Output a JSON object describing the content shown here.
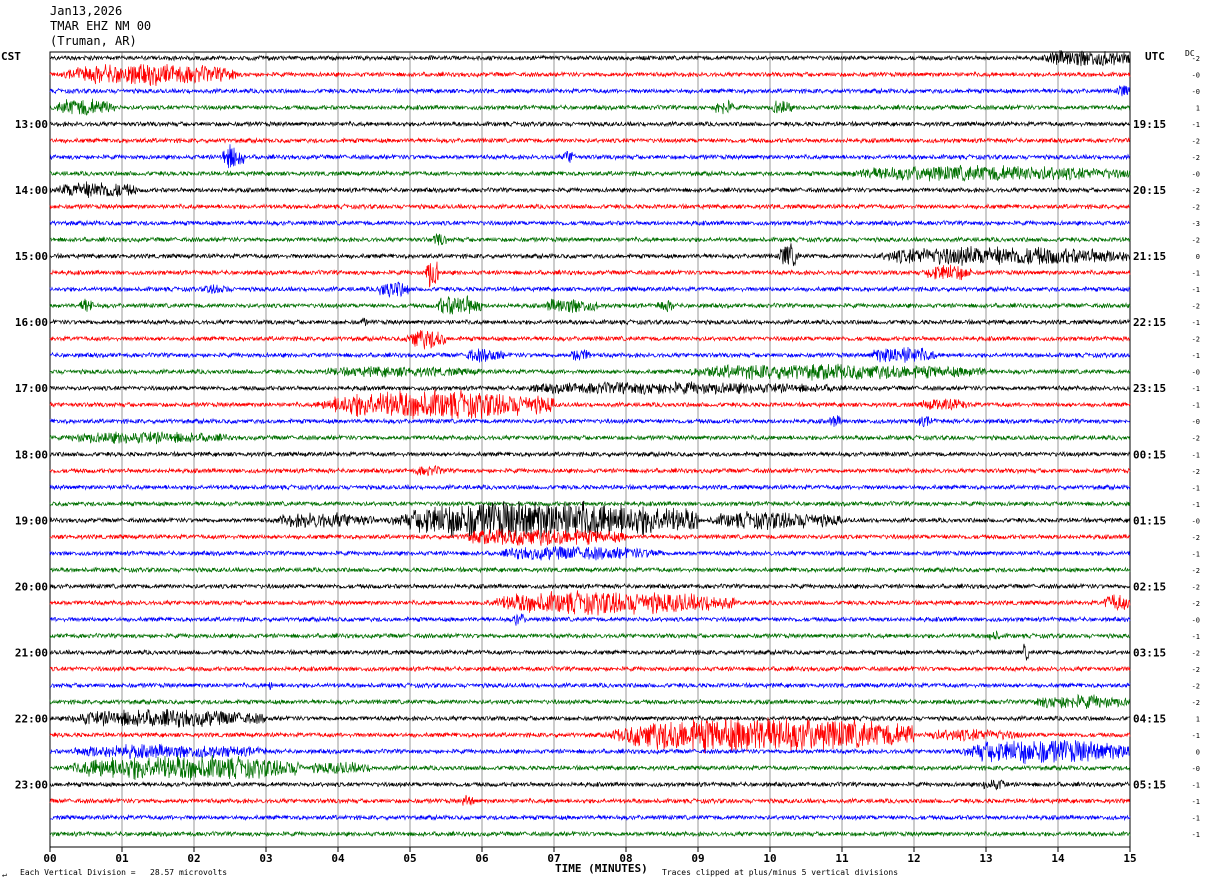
{
  "header": {
    "date": "Jan13,2026",
    "station": "TMAR EHZ NM 00",
    "location": "(Truman, AR)"
  },
  "left_zone": "CST",
  "right_zone": "UTC",
  "dc_label": "DC",
  "footer": {
    "corner_mark": "↵",
    "scale_note": "Each Vertical Division =   28.57 microvolts",
    "xlabel": "TIME (MINUTES)",
    "clip_note": "Traces clipped at plus/minus 5 vertical divisions"
  },
  "colors": {
    "trace_cycle": [
      "#000000",
      "#ff0000",
      "#0000ff",
      "#007000"
    ],
    "grid": "#000000",
    "background": "#ffffff"
  },
  "chart_data": {
    "type": "line",
    "title": "TMAR EHZ NM 00",
    "xlabel": "TIME (MINUTES)",
    "xlim": [
      0,
      15
    ],
    "x_ticks": [
      "00",
      "01",
      "02",
      "03",
      "04",
      "05",
      "06",
      "07",
      "08",
      "09",
      "10",
      "11",
      "12",
      "13",
      "14",
      "15"
    ],
    "trace_count": 48,
    "minutes_per_trace": 15,
    "left_hour_labels": [
      {
        "trace": 4,
        "label": "13:00"
      },
      {
        "trace": 8,
        "label": "14:00"
      },
      {
        "trace": 12,
        "label": "15:00"
      },
      {
        "trace": 16,
        "label": "16:00"
      },
      {
        "trace": 20,
        "label": "17:00"
      },
      {
        "trace": 24,
        "label": "18:00"
      },
      {
        "trace": 28,
        "label": "19:00"
      },
      {
        "trace": 32,
        "label": "20:00"
      },
      {
        "trace": 36,
        "label": "21:00"
      },
      {
        "trace": 40,
        "label": "22:00"
      },
      {
        "trace": 44,
        "label": "23:00"
      }
    ],
    "right_hour_labels": [
      {
        "trace": 4,
        "label": "19:15"
      },
      {
        "trace": 8,
        "label": "20:15"
      },
      {
        "trace": 12,
        "label": "21:15"
      },
      {
        "trace": 16,
        "label": "22:15"
      },
      {
        "trace": 20,
        "label": "23:15"
      },
      {
        "trace": 24,
        "label": "00:15"
      },
      {
        "trace": 28,
        "label": "01:15"
      },
      {
        "trace": 32,
        "label": "02:15"
      },
      {
        "trace": 36,
        "label": "03:15"
      },
      {
        "trace": 40,
        "label": "04:15"
      },
      {
        "trace": 44,
        "label": "05:15"
      }
    ],
    "dc_offsets": [
      -2,
      0,
      0,
      1,
      -1,
      -2,
      -2,
      0,
      -2,
      -2,
      -3,
      -2,
      0,
      -1,
      -1,
      -2,
      -1,
      -2,
      -1,
      0,
      -1,
      -1,
      0,
      -2,
      -1,
      -2,
      -1,
      -1,
      0,
      -2,
      -1,
      -2,
      -2,
      -2,
      0,
      -1,
      -2,
      -2,
      -2,
      -2,
      1,
      -1,
      0,
      0,
      -1,
      -1,
      -1,
      -1
    ],
    "base_noise": 2.5,
    "events": [
      {
        "trace": 0,
        "start": 13.7,
        "end": 15,
        "amp": 10
      },
      {
        "trace": 1,
        "start": 0,
        "end": 2.6,
        "amp": 12
      },
      {
        "trace": 2,
        "start": 14.8,
        "end": 15,
        "amp": 8
      },
      {
        "trace": 3,
        "start": 0,
        "end": 0.9,
        "amp": 10
      },
      {
        "trace": 3,
        "start": 9.2,
        "end": 9.5,
        "amp": 9
      },
      {
        "trace": 3,
        "start": 10.0,
        "end": 10.3,
        "amp": 9
      },
      {
        "trace": 6,
        "start": 2.35,
        "end": 2.7,
        "amp": 14
      },
      {
        "trace": 6,
        "start": 7.1,
        "end": 7.3,
        "amp": 8
      },
      {
        "trace": 7,
        "start": 10.7,
        "end": 15,
        "amp": 9
      },
      {
        "trace": 8,
        "start": 0,
        "end": 1.2,
        "amp": 10
      },
      {
        "trace": 11,
        "start": 5.3,
        "end": 5.5,
        "amp": 8
      },
      {
        "trace": 12,
        "start": 11.2,
        "end": 15,
        "amp": 11
      },
      {
        "trace": 12,
        "start": 10.1,
        "end": 10.4,
        "amp": 14
      },
      {
        "trace": 13,
        "start": 5.2,
        "end": 5.4,
        "amp": 18
      },
      {
        "trace": 13,
        "start": 12.1,
        "end": 12.8,
        "amp": 10
      },
      {
        "trace": 14,
        "start": 4.5,
        "end": 5.0,
        "amp": 10
      },
      {
        "trace": 14,
        "start": 2.1,
        "end": 2.5,
        "amp": 6
      },
      {
        "trace": 15,
        "start": 0.4,
        "end": 0.6,
        "amp": 9
      },
      {
        "trace": 15,
        "start": 5.3,
        "end": 6.0,
        "amp": 12
      },
      {
        "trace": 15,
        "start": 6.8,
        "end": 7.6,
        "amp": 9
      },
      {
        "trace": 15,
        "start": 8.4,
        "end": 8.7,
        "amp": 7
      },
      {
        "trace": 16,
        "start": 4.3,
        "end": 4.4,
        "amp": 6
      },
      {
        "trace": 17,
        "start": 4.9,
        "end": 5.5,
        "amp": 12
      },
      {
        "trace": 18,
        "start": 5.7,
        "end": 6.3,
        "amp": 8
      },
      {
        "trace": 18,
        "start": 7.2,
        "end": 7.5,
        "amp": 8
      },
      {
        "trace": 18,
        "start": 11.3,
        "end": 12.3,
        "amp": 10
      },
      {
        "trace": 19,
        "start": 3.5,
        "end": 6.0,
        "amp": 6
      },
      {
        "trace": 19,
        "start": 8.4,
        "end": 13.0,
        "amp": 9
      },
      {
        "trace": 20,
        "start": 6.0,
        "end": 11.0,
        "amp": 7
      },
      {
        "trace": 21,
        "start": 3.5,
        "end": 7.0,
        "amp": 16
      },
      {
        "trace": 21,
        "start": 12.0,
        "end": 12.8,
        "amp": 7
      },
      {
        "trace": 22,
        "start": 10.8,
        "end": 11.0,
        "amp": 7
      },
      {
        "trace": 22,
        "start": 12.0,
        "end": 12.3,
        "amp": 6
      },
      {
        "trace": 23,
        "start": 0,
        "end": 2.5,
        "amp": 7
      },
      {
        "trace": 25,
        "start": 5.0,
        "end": 5.5,
        "amp": 6
      },
      {
        "trace": 28,
        "start": 3.0,
        "end": 4.5,
        "amp": 9
      },
      {
        "trace": 28,
        "start": 4.5,
        "end": 9.0,
        "amp": 22
      },
      {
        "trace": 28,
        "start": 9.0,
        "end": 11.0,
        "amp": 10
      },
      {
        "trace": 29,
        "start": 5.5,
        "end": 8.0,
        "amp": 10
      },
      {
        "trace": 30,
        "start": 6.0,
        "end": 8.5,
        "amp": 8
      },
      {
        "trace": 33,
        "start": 5.8,
        "end": 9.5,
        "amp": 13
      },
      {
        "trace": 33,
        "start": 14.6,
        "end": 15,
        "amp": 10
      },
      {
        "trace": 34,
        "start": 6.4,
        "end": 6.6,
        "amp": 8
      },
      {
        "trace": 35,
        "start": 13.0,
        "end": 13.2,
        "amp": 7
      },
      {
        "trace": 36,
        "start": 13.5,
        "end": 13.6,
        "amp": 10
      },
      {
        "trace": 38,
        "start": 3.0,
        "end": 3.1,
        "amp": 6
      },
      {
        "trace": 39,
        "start": 13.5,
        "end": 15,
        "amp": 8
      },
      {
        "trace": 40,
        "start": 0,
        "end": 3.0,
        "amp": 10
      },
      {
        "trace": 41,
        "start": 7.5,
        "end": 12.0,
        "amp": 20
      },
      {
        "trace": 41,
        "start": 12.0,
        "end": 13.5,
        "amp": 7
      },
      {
        "trace": 42,
        "start": 12.5,
        "end": 15,
        "amp": 14
      },
      {
        "trace": 42,
        "start": 0,
        "end": 3.0,
        "amp": 8
      },
      {
        "trace": 43,
        "start": 0,
        "end": 3.5,
        "amp": 14
      },
      {
        "trace": 43,
        "start": 3.5,
        "end": 4.5,
        "amp": 7
      },
      {
        "trace": 44,
        "start": 12.9,
        "end": 13.3,
        "amp": 7
      },
      {
        "trace": 45,
        "start": 5.7,
        "end": 5.9,
        "amp": 7
      }
    ]
  }
}
